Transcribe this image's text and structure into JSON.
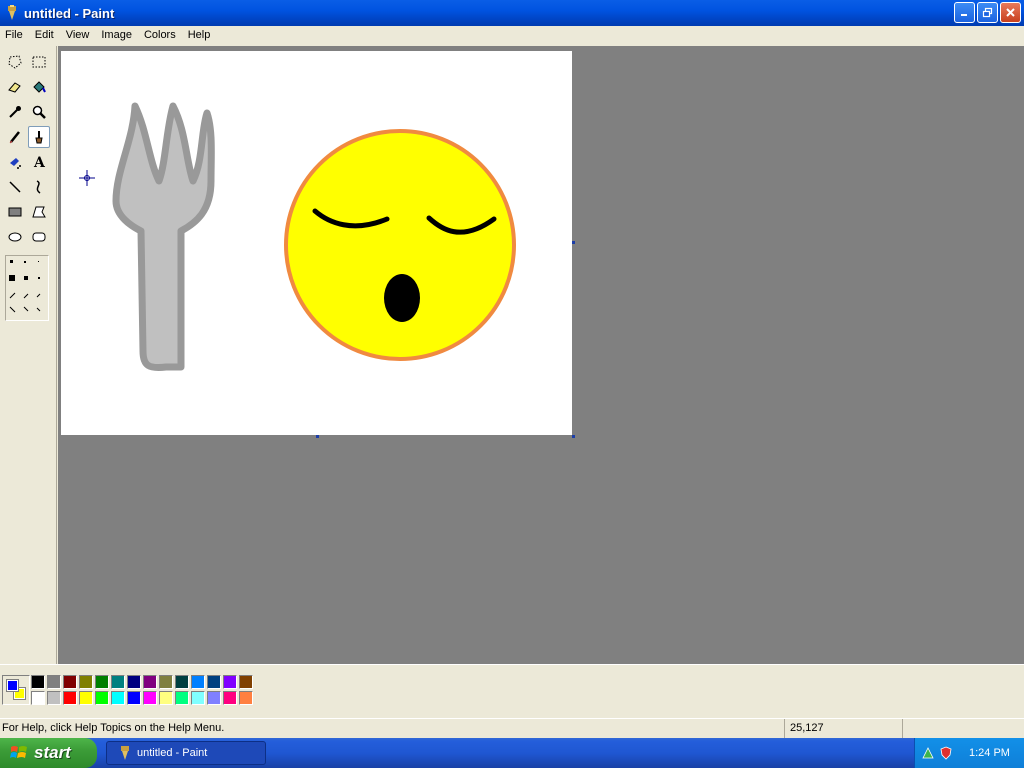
{
  "window": {
    "title": "untitled - Paint"
  },
  "menu": {
    "items": [
      "File",
      "Edit",
      "View",
      "Image",
      "Colors",
      "Help"
    ]
  },
  "toolbox": {
    "tools": [
      "free-form-select",
      "select",
      "eraser",
      "fill-with-color",
      "pick-color",
      "magnifier",
      "pencil",
      "brush",
      "airbrush",
      "text",
      "line",
      "curve",
      "rectangle",
      "polygon",
      "ellipse",
      "rounded-rectangle"
    ],
    "active_tool": "brush"
  },
  "colors": {
    "foreground": "#0000ff",
    "background": "#ffff00",
    "palette_row1": [
      "#000000",
      "#808080",
      "#800000",
      "#808000",
      "#008000",
      "#008080",
      "#000080",
      "#800080",
      "#808040",
      "#004040",
      "#0080ff",
      "#004080",
      "#8000ff",
      "#804000"
    ],
    "palette_row2": [
      "#ffffff",
      "#c0c0c0",
      "#ff0000",
      "#ffff00",
      "#00ff00",
      "#00ffff",
      "#0000ff",
      "#ff00ff",
      "#ffff80",
      "#00ff80",
      "#80ffff",
      "#8080ff",
      "#ff0080",
      "#ff8040"
    ]
  },
  "status": {
    "help": "For Help, click Help Topics on the Help Menu.",
    "coords": "25,127"
  },
  "taskbar": {
    "start": "start",
    "task": "untitled - Paint",
    "clock": "1:24 PM"
  }
}
